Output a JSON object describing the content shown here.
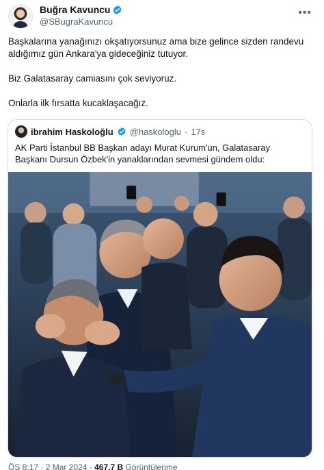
{
  "author": {
    "name": "Buğra Kavuncu",
    "handle": "@SBugraKavuncu",
    "verified_color": "#1d9bf0"
  },
  "tweet": {
    "paragraphs": [
      "Başkalarına yanağınızı okşatıyorsunuz ama bize gelince sizden randevu aldığımız gün Ankara'ya gideceğiniz tutuyor.",
      "Biz Galatasaray camiasını çok seviyoruz.",
      "Onlarla ilk fırsatta kucaklaşacağız."
    ]
  },
  "quoted": {
    "name": "ibrahim Haskoloğlu",
    "handle": "@haskologlu",
    "separator": "·",
    "time": "17s",
    "text": "AK Parti İstanbul BB Başkan adayı Murat Kurum'un, Galatasaray Başkanı Dursun Özbek'in yanaklarından sevmesi gündem oldu:"
  },
  "meta": {
    "time": "ÖS 8:17",
    "date": "2 Mar 2024",
    "views_count": "467,7 B",
    "views_label": "Görüntülenme"
  },
  "icons": {
    "more": "more-horizontal-icon",
    "verified": "verified-badge-icon"
  },
  "colors": {
    "text": "#0f1419",
    "secondary": "#536471",
    "border": "#cfd9de",
    "accent": "#1d9bf0"
  }
}
